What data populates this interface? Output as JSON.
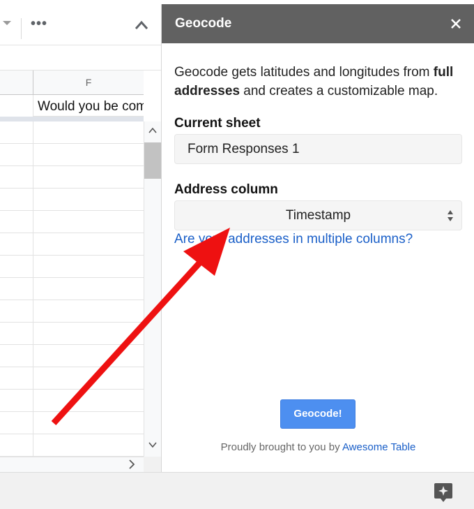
{
  "spreadsheet": {
    "column_f_header": "F",
    "header_cell_text": "Would you be comfortable"
  },
  "sidebar": {
    "title": "Geocode",
    "description_part1": "Geocode gets latitudes and longitudes from ",
    "description_bold": "full addresses",
    "description_part2": " and creates a customizable map.",
    "current_sheet_label": "Current sheet",
    "current_sheet_value": "Form Responses 1",
    "address_column_label": "Address column",
    "address_column_value": "Timestamp",
    "multiple_columns_link": "Are your addresses in multiple columns?",
    "geocode_button": "Geocode!",
    "footer_text": "Proudly brought to you by ",
    "footer_link": "Awesome Table"
  },
  "colors": {
    "header_bg": "#616161",
    "button_bg": "#4d8ff0",
    "link": "#1a5fc8",
    "annotation_arrow": "#ee1111"
  }
}
